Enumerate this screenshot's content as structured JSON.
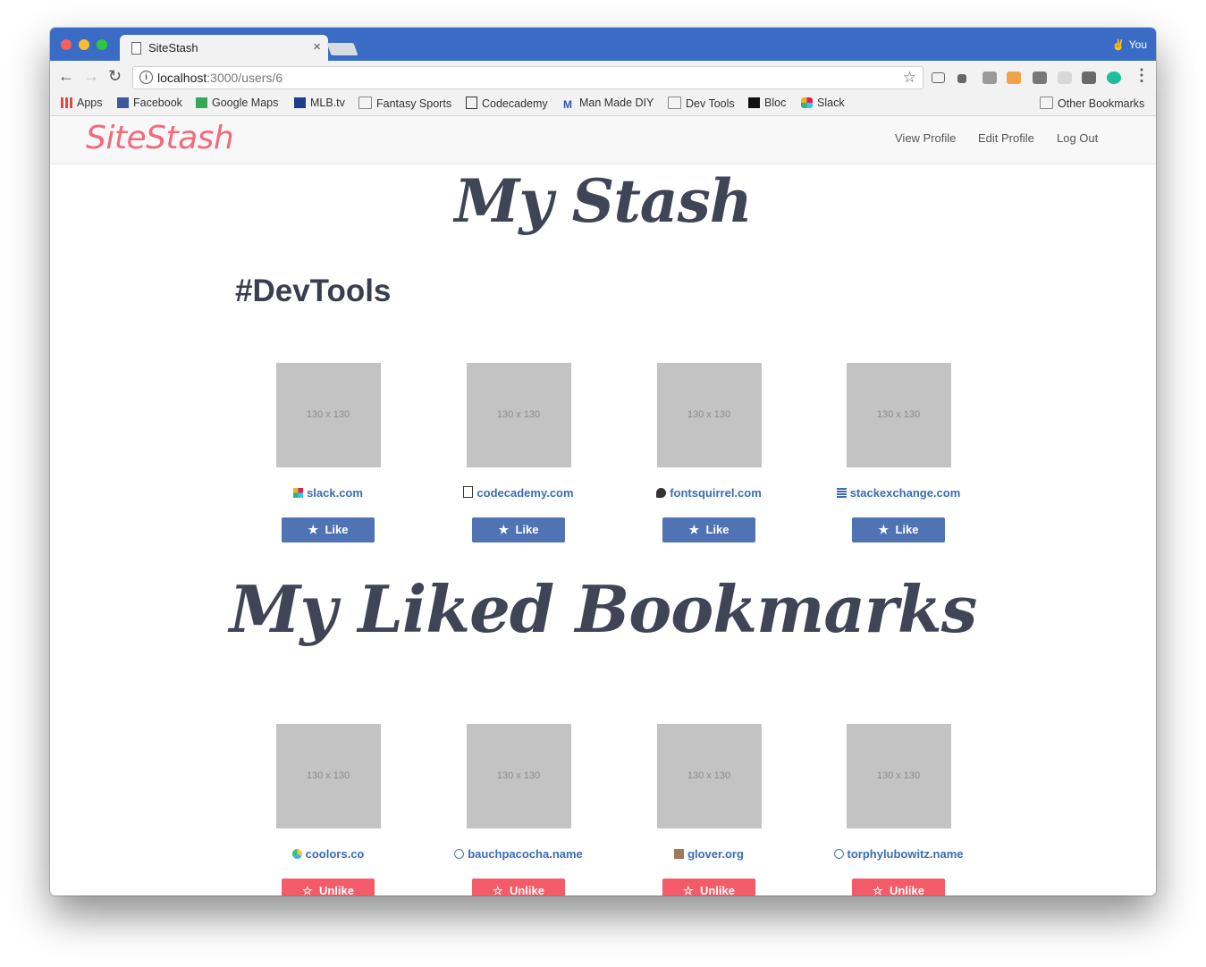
{
  "browser": {
    "tab_title": "SiteStash",
    "tab_close": "×",
    "profile_name": "You",
    "url_host": "localhost",
    "url_rest": ":3000/users/6"
  },
  "bookmarks_bar": {
    "items": [
      {
        "label": "Apps",
        "icon": "apps-grid-icon"
      },
      {
        "label": "Facebook",
        "icon": "facebook-icon"
      },
      {
        "label": "Google Maps",
        "icon": "google-maps-icon"
      },
      {
        "label": "MLB.tv",
        "icon": "mlb-icon"
      },
      {
        "label": "Fantasy Sports",
        "icon": "folder-icon"
      },
      {
        "label": "Codecademy",
        "icon": "codecademy-icon"
      },
      {
        "label": "Man Made DIY",
        "icon": "man-made-icon"
      },
      {
        "label": "Dev Tools",
        "icon": "folder-icon"
      },
      {
        "label": "Bloc",
        "icon": "bloc-icon"
      },
      {
        "label": "Slack",
        "icon": "slack-icon"
      }
    ],
    "other": "Other Bookmarks"
  },
  "site": {
    "logo": "SiteStash",
    "nav": [
      "View Profile",
      "Edit Profile",
      "Log Out"
    ]
  },
  "stash": {
    "heading": "My Stash",
    "topic": "#DevTools",
    "cards": [
      {
        "thumb": "130 x 130",
        "site": "slack.com",
        "favicon": "slack-favicon",
        "button": "Like"
      },
      {
        "thumb": "130 x 130",
        "site": "codecademy.com",
        "favicon": "codecademy-favicon",
        "button": "Like"
      },
      {
        "thumb": "130 x 130",
        "site": "fontsquirrel.com",
        "favicon": "fontsquirrel-favicon",
        "button": "Like"
      },
      {
        "thumb": "130 x 130",
        "site": "stackexchange.com",
        "favicon": "stackexchange-favicon",
        "button": "Like"
      }
    ]
  },
  "liked": {
    "heading": "My Liked Bookmarks",
    "cards": [
      {
        "thumb": "130 x 130",
        "site": "coolors.co",
        "favicon": "coolors-favicon",
        "button": "Unlike"
      },
      {
        "thumb": "130 x 130",
        "site": "bauchpacocha.name",
        "favicon": "globe-favicon",
        "button": "Unlike"
      },
      {
        "thumb": "130 x 130",
        "site": "glover.org",
        "favicon": "glover-favicon",
        "button": "Unlike"
      },
      {
        "thumb": "130 x 130",
        "site": "torphylubowitz.name",
        "favicon": "globe-favicon",
        "button": "Unlike"
      }
    ]
  },
  "colors": {
    "like": "#4f73b4",
    "unlike": "#f45b69",
    "logo": "#f06c7d",
    "link": "#3b6db2",
    "heading": "#3f4556"
  }
}
